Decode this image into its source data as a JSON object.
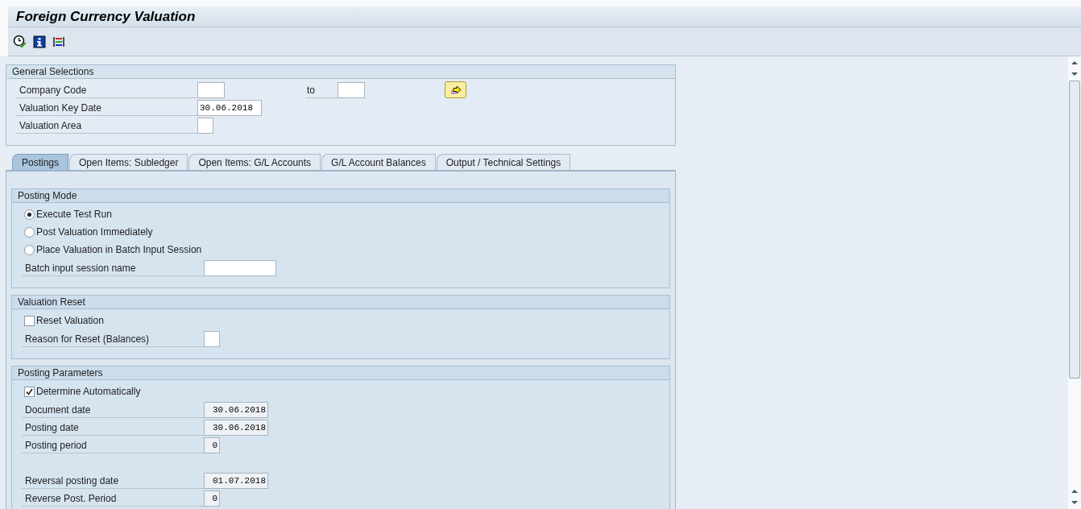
{
  "window": {
    "title": "Foreign Currency Valuation"
  },
  "general_selections": {
    "title": "General Selections",
    "rows": [
      {
        "label": "Company Code",
        "value": "",
        "readonly": false,
        "to_label": "to",
        "to_value": ""
      },
      {
        "label": "Valuation Key Date",
        "value": "30.06.2018",
        "readonly": false
      },
      {
        "label": "Valuation Area",
        "value": "",
        "readonly": false
      }
    ]
  },
  "tabs": [
    {
      "label": "Postings",
      "selected": true
    },
    {
      "label": "Open Items: Subledger",
      "selected": false
    },
    {
      "label": "Open Items: G/L Accounts",
      "selected": false
    },
    {
      "label": "G/L Account Balances",
      "selected": false
    },
    {
      "label": "Output / Technical Settings",
      "selected": false
    }
  ],
  "sections": [
    {
      "title": "Posting Mode",
      "items": [
        {
          "kind": "radio",
          "label": "Execute Test Run",
          "selected": true
        },
        {
          "kind": "radio",
          "label": "Post Valuation Immediately",
          "selected": false
        },
        {
          "kind": "radio",
          "label": "Place Valuation in Batch Input Session",
          "selected": false
        },
        {
          "kind": "field",
          "label": "Batch input session name",
          "value": "",
          "readonly": false
        }
      ]
    },
    {
      "title": "Valuation Reset",
      "items": [
        {
          "kind": "checkbox",
          "label": "Reset Valuation",
          "checked": false
        },
        {
          "kind": "field",
          "label": "Reason for Reset (Balances)",
          "value": "",
          "readonly": false
        }
      ]
    },
    {
      "title": "Posting Parameters",
      "items": [
        {
          "kind": "checkbox",
          "label": "Determine Automatically",
          "checked": true
        },
        {
          "kind": "field",
          "label": "Document date",
          "value": "30.06.2018",
          "readonly": true
        },
        {
          "kind": "field",
          "label": "Posting date",
          "value": "30.06.2018",
          "readonly": true
        },
        {
          "kind": "field",
          "label": "Posting period",
          "value": "0",
          "readonly": true
        },
        {
          "kind": "spacer"
        },
        {
          "kind": "field",
          "label": "Reversal posting date",
          "value": "01.07.2018",
          "readonly": true
        },
        {
          "kind": "field",
          "label": "Reverse Post. Period",
          "value": "0",
          "readonly": true
        }
      ]
    }
  ]
}
